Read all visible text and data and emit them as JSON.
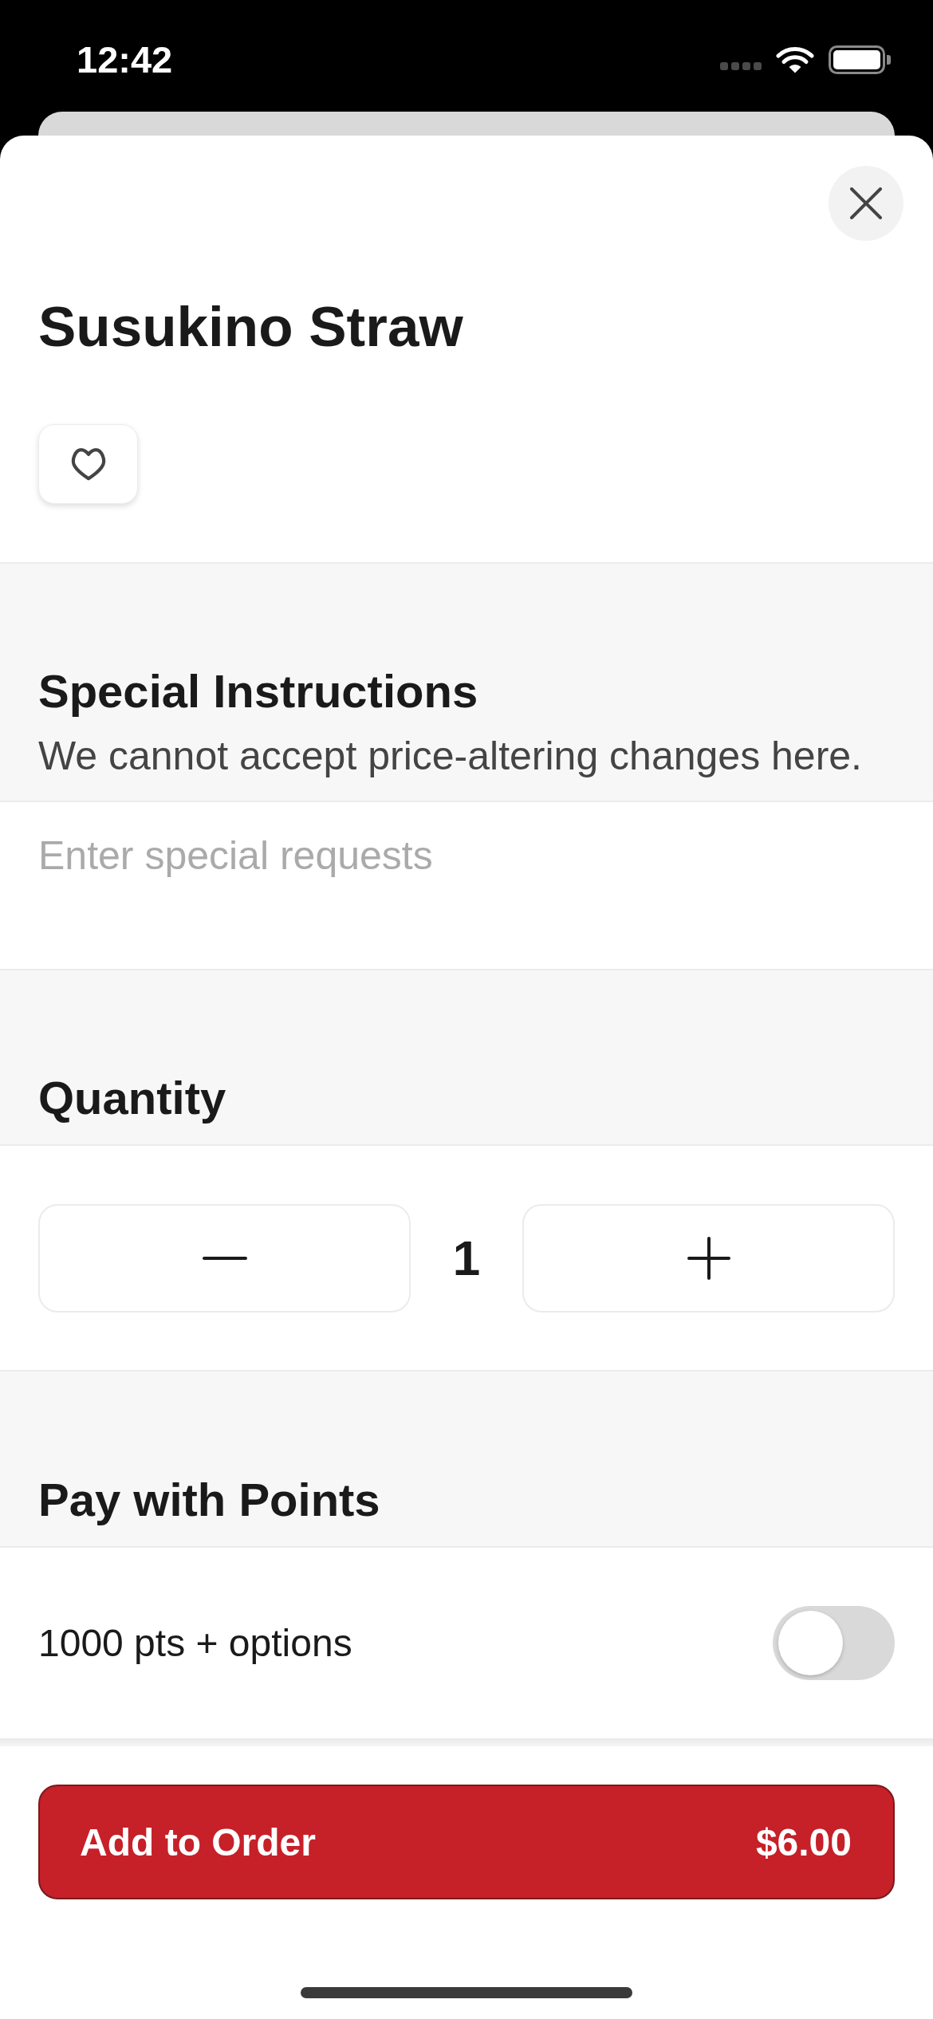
{
  "status_bar": {
    "time": "12:42"
  },
  "item": {
    "title": "Susukino Straw",
    "favorited": false
  },
  "special_instructions": {
    "title": "Special Instructions",
    "subtitle": "We cannot accept price-altering changes here.",
    "placeholder": "Enter special requests"
  },
  "quantity": {
    "title": "Quantity",
    "value": "1"
  },
  "points": {
    "title": "Pay with Points",
    "option": "1000 pts + options",
    "on": false
  },
  "footer": {
    "label": "Add to Order",
    "price": "$6.00"
  }
}
